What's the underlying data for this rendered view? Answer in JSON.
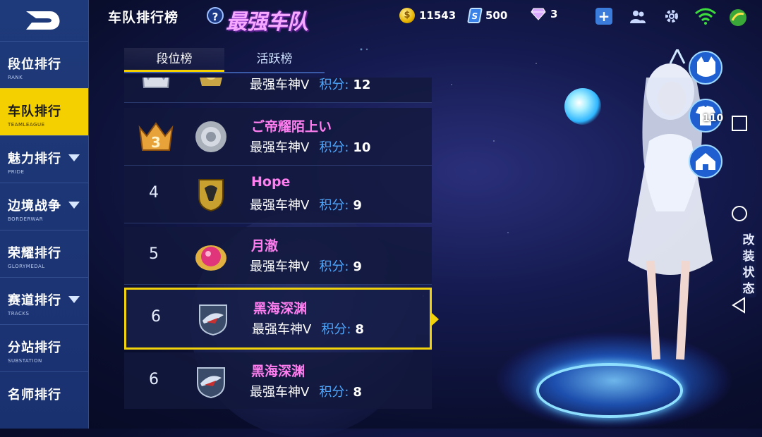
{
  "header": {
    "title": "车队排行榜",
    "help": "?",
    "brand": "最强车队"
  },
  "resources": {
    "coins": "11543",
    "cards": "500",
    "gems": "3",
    "card_glyph": "S"
  },
  "sidebar": {
    "items": [
      {
        "label": "段位排行",
        "sub": "RANK"
      },
      {
        "label": "车队排行",
        "sub": "TEAMLEAGUE"
      },
      {
        "label": "魅力排行",
        "sub": "PRIDE"
      },
      {
        "label": "边境战争",
        "sub": "BORDERWAR"
      },
      {
        "label": "荣耀排行",
        "sub": "GLORYMEDAL"
      },
      {
        "label": "赛道排行",
        "sub": "TRACKS"
      },
      {
        "label": "分站排行",
        "sub": "SUBSTATION"
      },
      {
        "label": "名师排行",
        "sub": ""
      }
    ]
  },
  "tabs": [
    {
      "label": "段位榜"
    },
    {
      "label": "活跃榜"
    }
  ],
  "rows": [
    {
      "rank": "",
      "name": "",
      "title": "最强车神V",
      "score_label": "积分:",
      "score": "12"
    },
    {
      "rank": "3",
      "name": "ご帝耀陌上い",
      "title": "最强车神V",
      "score_label": "积分:",
      "score": "10"
    },
    {
      "rank": "4",
      "name": "Hope",
      "title": "最强车神V",
      "score_label": "积分:",
      "score": "9"
    },
    {
      "rank": "5",
      "name": "月澈",
      "title": "最强车神V",
      "score_label": "积分:",
      "score": "9"
    },
    {
      "rank": "6",
      "name": "黑海深渊",
      "title": "最强车神V",
      "score_label": "积分:",
      "score": "8"
    },
    {
      "rank": "6",
      "name": "黑海深渊",
      "title": "最强车神V",
      "score_label": "积分:",
      "score": "8"
    }
  ],
  "right_panel": {
    "level": "110",
    "mod_label": [
      "改",
      "装",
      "状",
      "态"
    ]
  },
  "colors": {
    "accent": "#f5d000",
    "name_pink": "#ff7ef0",
    "score_blue": "#4ea8ff",
    "sidebar": "#1f3a7a"
  }
}
